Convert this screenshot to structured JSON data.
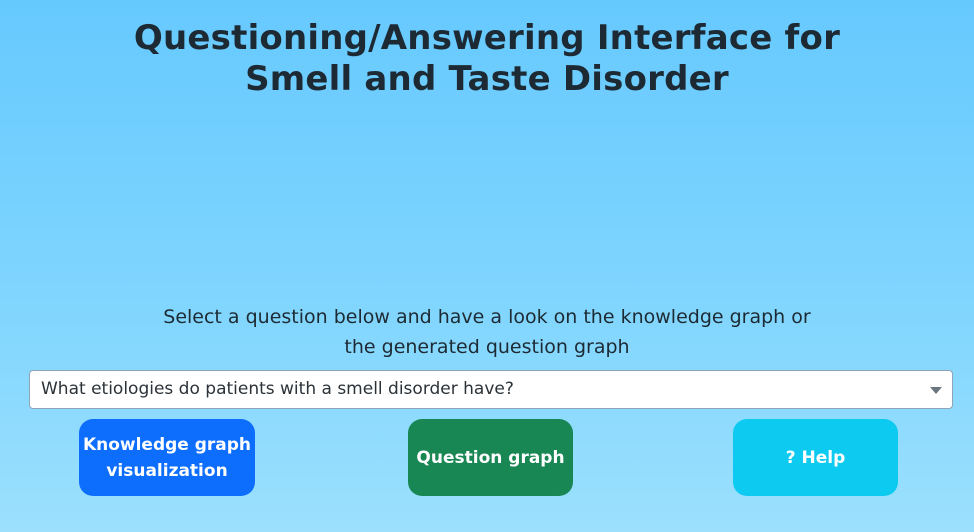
{
  "header": {
    "title_line1": "Questioning/Answering Interface for",
    "title_line2": "Smell and Taste Disorder"
  },
  "instructions": {
    "line1": "Select a question below and have a look on the knowledge graph or",
    "line2": "the generated question graph"
  },
  "question_select": {
    "selected_value": "What etiologies do patients with a smell disorder have?"
  },
  "buttons": {
    "knowledge_graph_line1": "Knowledge graph",
    "knowledge_graph_line2": "visualization",
    "question_graph": "Question graph",
    "help": "? Help"
  },
  "colors": {
    "background_top": "#66c9fe",
    "background_bottom": "#9ce0fd",
    "knowledge_graph_button": "#0d6efd",
    "question_graph_button": "#198754",
    "help_button": "#0dcaf0"
  }
}
